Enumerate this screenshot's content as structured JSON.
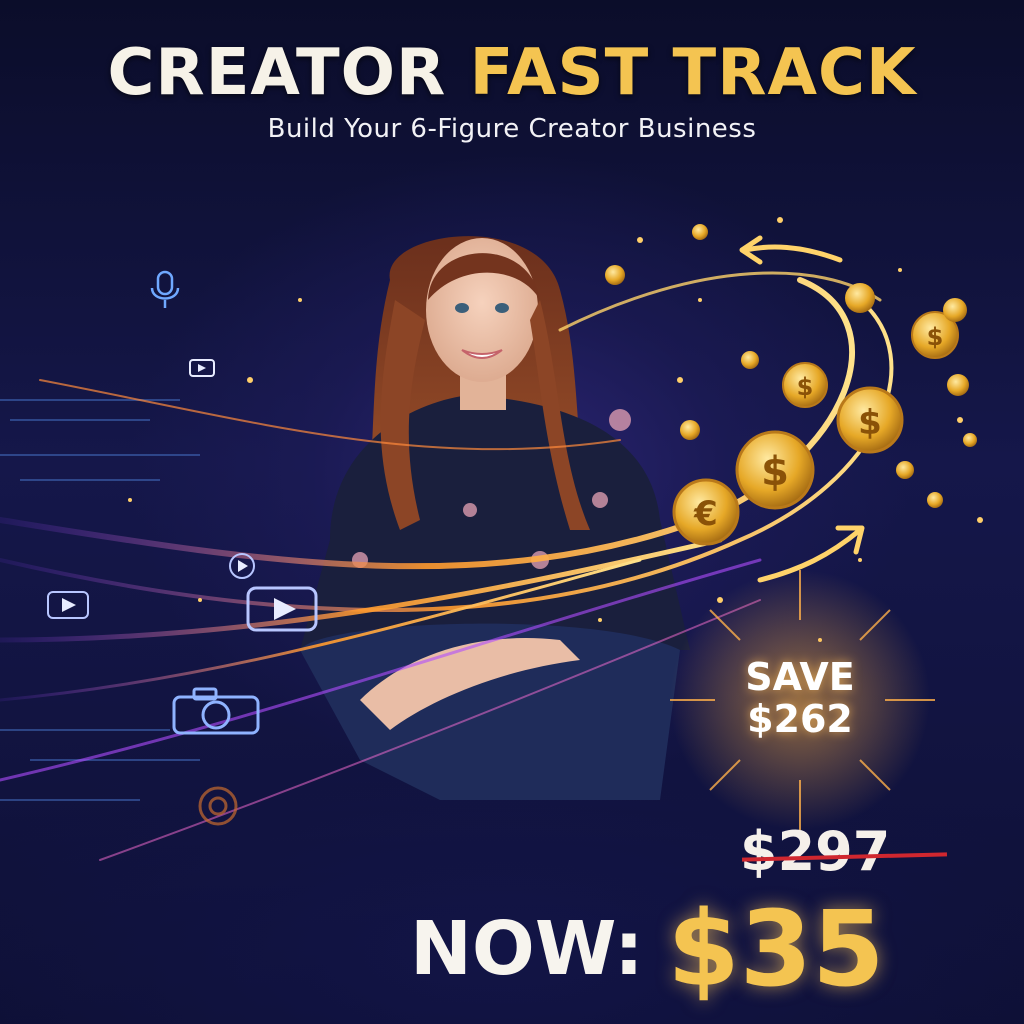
{
  "title": {
    "part1": "CREATOR",
    "part2": "FAST TRACK"
  },
  "subtitle": "Build Your 6-Figure Creator Business",
  "badge": {
    "line1": "SAVE",
    "line2": "$262"
  },
  "pricing": {
    "old_price": "$297",
    "now_label": "NOW:",
    "now_price": "$35"
  },
  "colors": {
    "accent_gold": "#f4c451",
    "background": "#0c0f30",
    "strike_red": "#d0272f"
  },
  "icons": [
    "microphone-icon",
    "play-icon",
    "camera-icon",
    "dollar-coin-icon",
    "euro-coin-icon",
    "arrow-up-icon"
  ]
}
